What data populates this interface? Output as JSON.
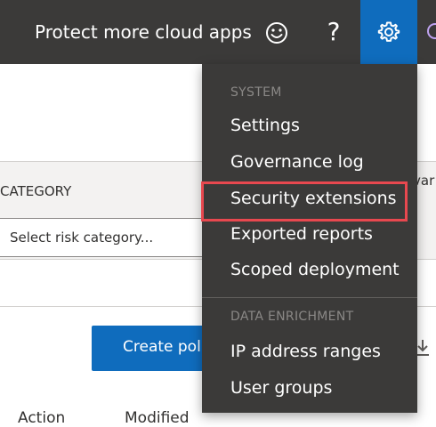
{
  "topbar": {
    "promo_label": "Protect more cloud apps",
    "icons": [
      "smiley-icon",
      "help-icon",
      "gear-icon"
    ],
    "help_glyph": "?"
  },
  "filters": {
    "category_header": "CATEGORY",
    "partial_header": "var",
    "category_select_value": "Select risk category..."
  },
  "actions": {
    "create_policy_label": "Create polic"
  },
  "table": {
    "columns": [
      "Action",
      "Modified"
    ]
  },
  "settings_menu": {
    "system_heading": "SYSTEM",
    "system_items": [
      "Settings",
      "Governance log",
      "Security extensions",
      "Exported reports",
      "Scoped deployment"
    ],
    "enrichment_heading": "DATA ENRICHMENT",
    "enrichment_items": [
      "IP address ranges",
      "User groups"
    ],
    "highlighted_item": "Security extensions"
  },
  "colors": {
    "topbar_bg": "#3b3a39",
    "accent": "#0f6cbd",
    "highlight_border": "#e8484f"
  }
}
